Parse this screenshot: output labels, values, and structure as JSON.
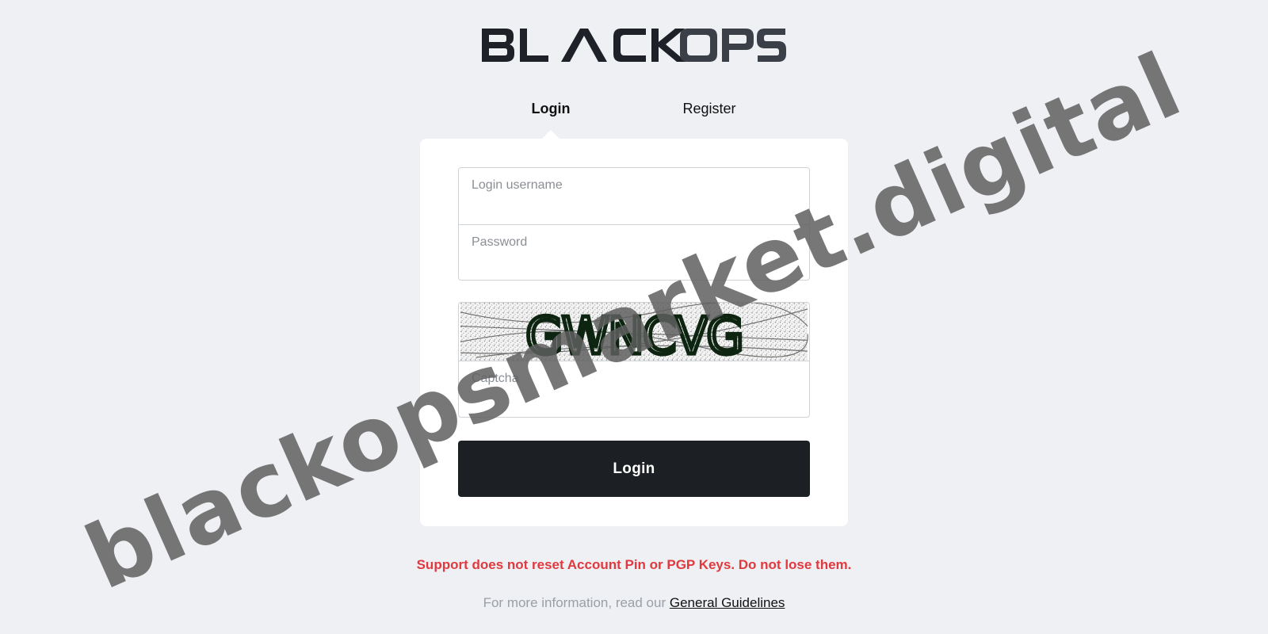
{
  "brand": {
    "logo_text": "BLACK OPS"
  },
  "tabs": [
    {
      "label": "Login",
      "active": true
    },
    {
      "label": "Register",
      "active": false
    }
  ],
  "form": {
    "username_label": "Login username",
    "username_value": "",
    "password_label": "Password",
    "password_value": "",
    "captcha_image_text": "GWNCVG",
    "captcha_label": "Captcha",
    "captcha_value": "",
    "submit_label": "Login"
  },
  "notice": {
    "warning": "Support does not reset Account Pin or PGP Keys. Do not lose them.",
    "info_prefix": "For more information, read our",
    "info_link": "General Guidelines"
  },
  "watermark": {
    "text": "blackopsmarket.digital"
  },
  "colors": {
    "background": "#eef0f4",
    "card": "#ffffff",
    "button": "#1c1f23",
    "warning": "#e0393e",
    "muted": "#9aa0a6",
    "captcha_ink": "#0c2410"
  }
}
